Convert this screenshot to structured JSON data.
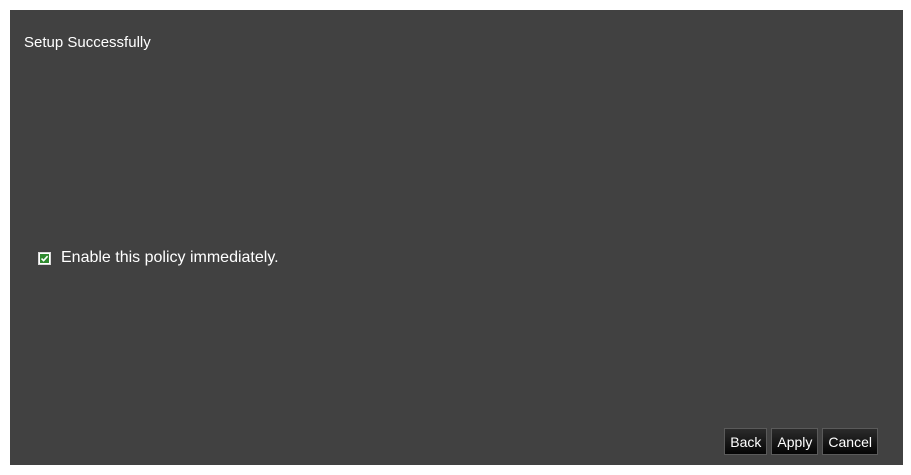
{
  "dialog": {
    "title": "Setup Successfully"
  },
  "option": {
    "label": "Enable this policy immediately.",
    "checked": true,
    "check_color": "#2f8a2f"
  },
  "buttons": {
    "back": "Back",
    "apply": "Apply",
    "cancel": "Cancel"
  },
  "colors": {
    "panel_background": "#414141",
    "text": "#ffffff"
  }
}
